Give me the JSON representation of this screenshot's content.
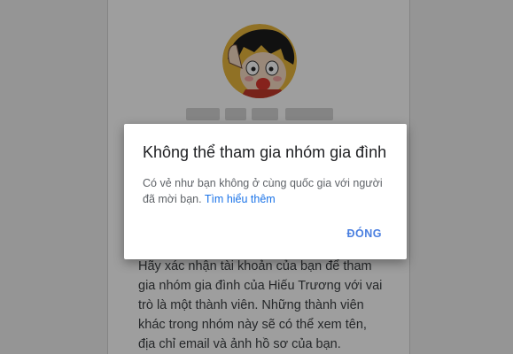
{
  "background_card": {
    "body_text": "Hãy xác nhận tài khoản của bạn để tham gia nhóm gia đình của Hiếu Trương với vai trò là một thành viên. Những thành viên khác trong nhóm này sẽ có thể xem tên, địa chỉ email và ảnh hồ sơ của bạn."
  },
  "dialog": {
    "title": "Không thể tham gia nhóm gia đình",
    "body": "Có vẻ như bạn không ở cùng quốc gia với người đã mời bạn.",
    "learn_more_label": "Tìm hiểu thêm",
    "close_label": "ĐÓNG"
  },
  "colors": {
    "accent": "#1a73e8",
    "scrim": "rgba(0,0,0,0.38)"
  }
}
